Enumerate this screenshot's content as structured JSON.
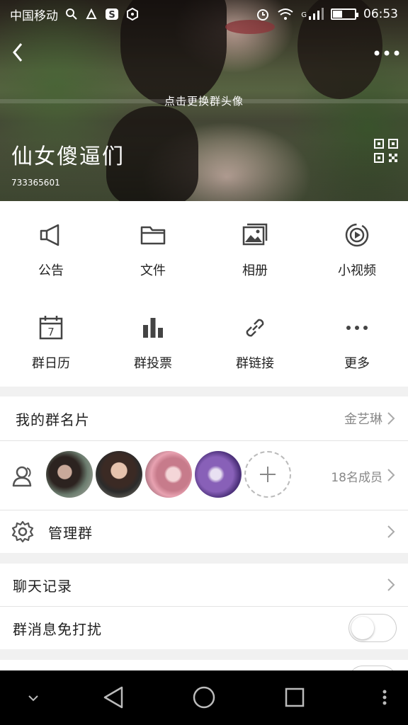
{
  "status_bar": {
    "carrier": "中国移动",
    "network": "G",
    "time": "06:53",
    "icons": [
      "search-icon",
      "app-icon",
      "s-app-icon",
      "hexagon-icon",
      "alarm-icon",
      "wifi-icon",
      "signal-icon",
      "battery-icon"
    ],
    "battery_level": 0.4
  },
  "header": {
    "change_avatar_hint": "点击更换群头像",
    "group_name": "仙女傻逼们",
    "group_id": "733365601"
  },
  "features": [
    {
      "label": "公告",
      "icon": "megaphone-icon"
    },
    {
      "label": "文件",
      "icon": "folder-icon"
    },
    {
      "label": "相册",
      "icon": "photo-album-icon"
    },
    {
      "label": "小视频",
      "icon": "video-icon"
    },
    {
      "label": "群日历",
      "icon": "calendar-icon"
    },
    {
      "label": "群投票",
      "icon": "bar-chart-icon"
    },
    {
      "label": "群链接",
      "icon": "link-icon"
    },
    {
      "label": "更多",
      "icon": "more-icon"
    }
  ],
  "calendar_day": "7",
  "my_card": {
    "label": "我的群名片",
    "value": "金艺琳"
  },
  "members": {
    "count_label": "18名成员"
  },
  "manage": {
    "label": "管理群"
  },
  "chat_history": {
    "label": "聊天记录"
  },
  "mute": {
    "label": "群消息免打扰",
    "enabled": false
  },
  "colors": {
    "accent": "#222222",
    "secondary_text": "#888888",
    "divider": "#e3e3e3"
  }
}
